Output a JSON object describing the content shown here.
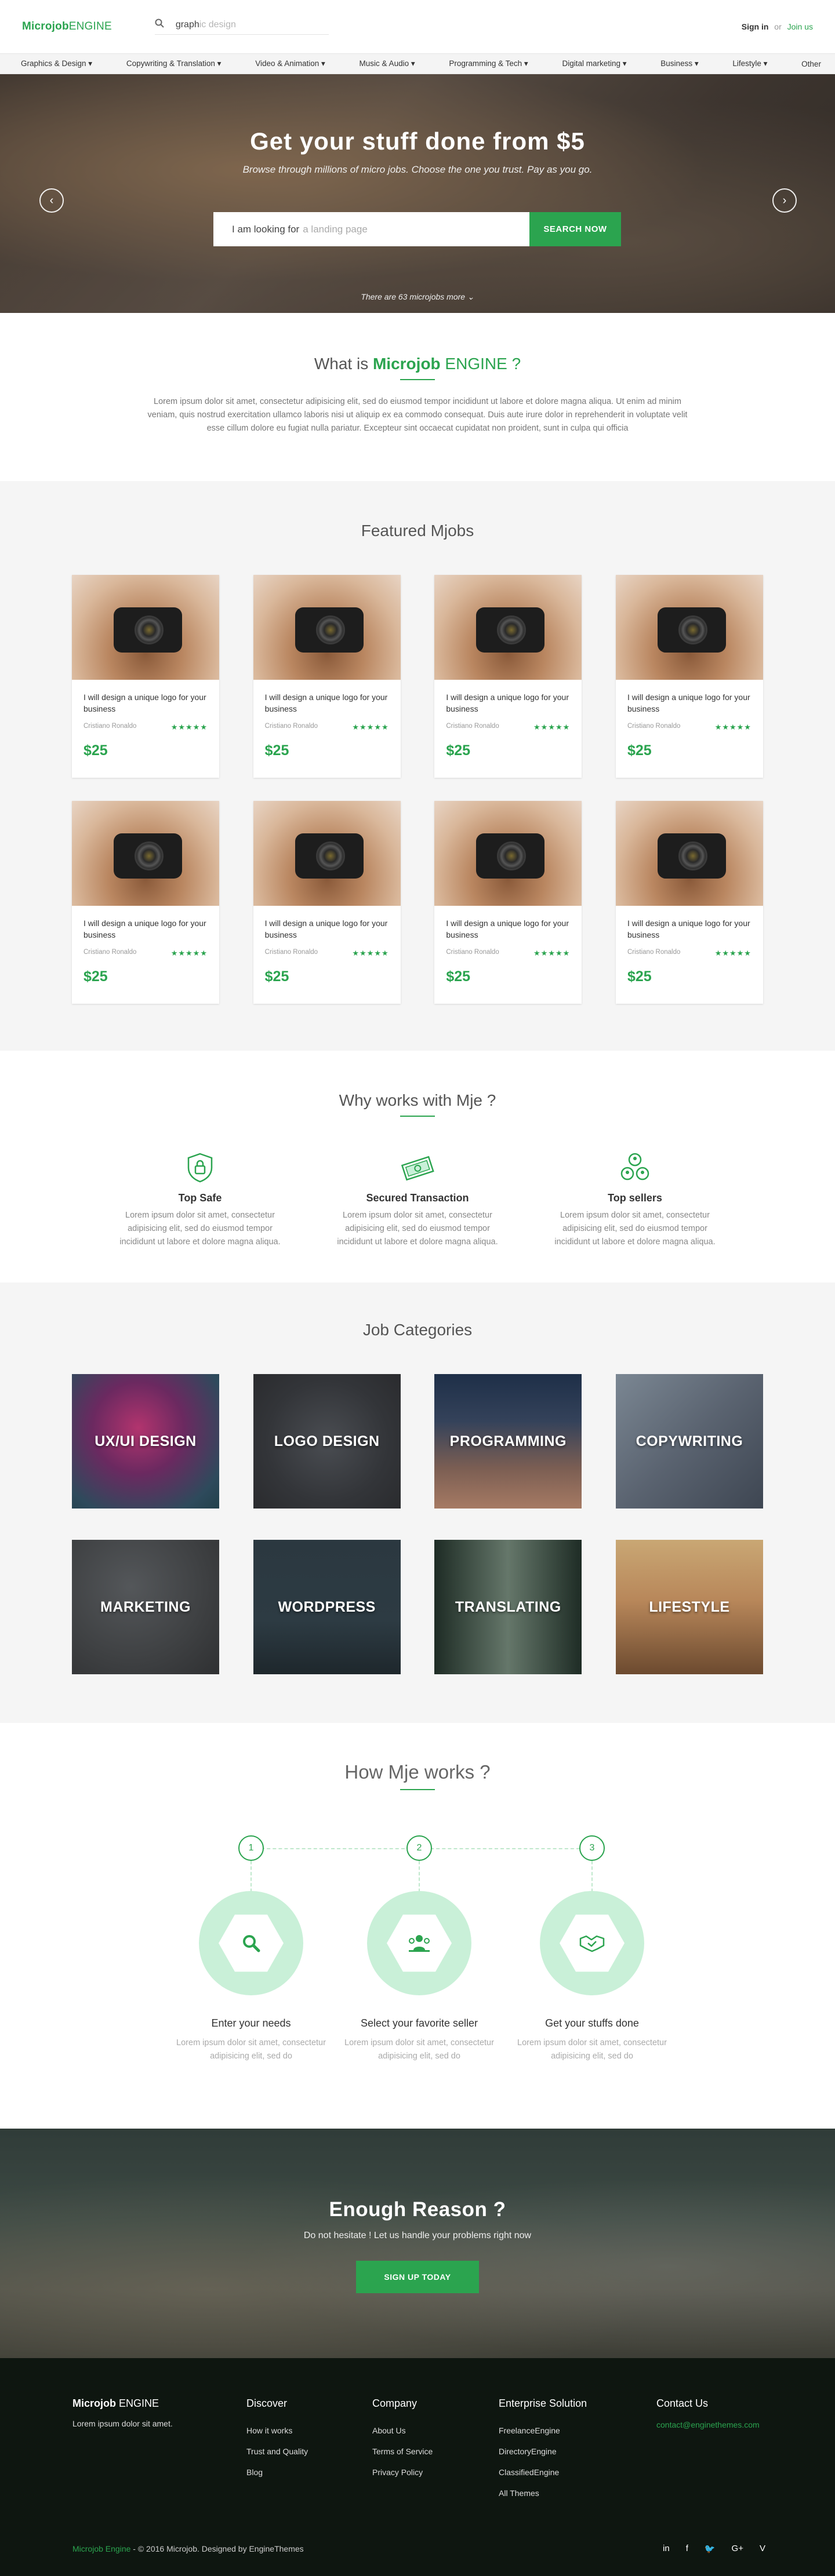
{
  "header": {
    "logo_bold": "Microjob",
    "logo_light": "ENGINE",
    "search_value": "graph",
    "search_placeholder": "ic design",
    "signin": "Sign in",
    "or": "or",
    "join": "Join us"
  },
  "catnav": [
    "Graphics & Design ▾",
    "Copywriting & Translation ▾",
    "Video & Animation ▾",
    "Music & Audio ▾",
    "Programming & Tech ▾",
    "Digital marketing ▾",
    "Business ▾",
    "Lifestyle ▾",
    "Other"
  ],
  "hero": {
    "title": "Get your stuff done from $5",
    "subtitle": "Browse through millions of micro jobs. Choose the one you trust. Pay as you go.",
    "search_label": "I am looking for",
    "search_placeholder": "a landing page",
    "search_button": "SEARCH NOW",
    "more": "There are 63 microjobs more ⌄"
  },
  "about": {
    "title_pre": "What is ",
    "title_bold": "Microjob",
    "title_post": " ENGINE ?",
    "text": "Lorem ipsum dolor sit amet, consectetur adipisicing elit, sed do eiusmod tempor incididunt ut labore et dolore magna aliqua. Ut enim ad minim veniam, quis nostrud exercitation ullamco laboris nisi ut aliquip ex ea commodo consequat. Duis aute irure dolor in reprehenderit in voluptate velit esse cillum dolore eu fugiat nulla pariatur. Excepteur sint occaecat cupidatat non proident, sunt in culpa qui officia"
  },
  "featured": {
    "title": "Featured Mjobs",
    "cards": [
      {
        "title": "I will design a unique logo for your business",
        "author": "Cristiano Ronaldo",
        "stars": "★★★★★",
        "price": "$25"
      },
      {
        "title": "I will design a unique logo for your business",
        "author": "Cristiano Ronaldo",
        "stars": "★★★★★",
        "price": "$25"
      },
      {
        "title": "I will design a unique logo for your business",
        "author": "Cristiano Ronaldo",
        "stars": "★★★★★",
        "price": "$25"
      },
      {
        "title": "I will design a unique logo for your business",
        "author": "Cristiano Ronaldo",
        "stars": "★★★★★",
        "price": "$25"
      },
      {
        "title": "I will design a unique logo for your business",
        "author": "Cristiano Ronaldo",
        "stars": "★★★★★",
        "price": "$25"
      },
      {
        "title": "I will design a unique logo for your business",
        "author": "Cristiano Ronaldo",
        "stars": "★★★★★",
        "price": "$25"
      },
      {
        "title": "I will design a unique logo for your business",
        "author": "Cristiano Ronaldo",
        "stars": "★★★★★",
        "price": "$25"
      },
      {
        "title": "I will design a unique logo for your business",
        "author": "Cristiano Ronaldo",
        "stars": "★★★★★",
        "price": "$25"
      }
    ]
  },
  "why": {
    "title": "Why works with Mje ?",
    "items": [
      {
        "icon": "safe-lock-icon",
        "title": "Top Safe",
        "text": "Lorem ipsum dolor sit amet, consectetur adipisicing elit, sed do eiusmod tempor incididunt ut labore et dolore magna aliqua."
      },
      {
        "icon": "money-icon",
        "title": "Secured Transaction",
        "text": "Lorem ipsum dolor sit amet, consectetur adipisicing elit, sed do eiusmod tempor incididunt ut labore et dolore magna aliqua."
      },
      {
        "icon": "sellers-icon",
        "title": "Top sellers",
        "text": "Lorem ipsum dolor sit amet, consectetur adipisicing elit, sed do eiusmod tempor incididunt ut labore et dolore magna aliqua."
      }
    ]
  },
  "categories": {
    "title": "Job Categories",
    "items": [
      "UX/UI DESIGN",
      "LOGO DESIGN",
      "PROGRAMMING",
      "COPYWRITING",
      "MARKETING",
      "WORDPRESS",
      "TRANSLATING",
      "LIFESTYLE"
    ]
  },
  "how": {
    "title": "How Mje works ?",
    "steps": [
      {
        "num": "1",
        "icon": "search-icon",
        "title": "Enter your needs",
        "text": "Lorem ipsum dolor sit amet, consectetur adipisicing elit, sed do"
      },
      {
        "num": "2",
        "icon": "users-icon",
        "title": "Select your favorite seller",
        "text": "Lorem ipsum dolor sit amet, consectetur adipisicing elit, sed do"
      },
      {
        "num": "3",
        "icon": "handshake-icon",
        "title": "Get your stuffs done",
        "text": "Lorem ipsum dolor sit amet, consectetur adipisicing elit, sed do"
      }
    ]
  },
  "cta": {
    "title": "Enough Reason ?",
    "text": "Do not hesitate ! Let us handle your problems right now",
    "button": "SIGN UP TODAY"
  },
  "footer": {
    "logo_bold": "Microjob",
    "logo_light": "ENGINE",
    "desc": "Lorem ipsum dolor sit amet.",
    "discover": {
      "title": "Discover",
      "links": [
        "How it works",
        "Trust and Quality",
        "Blog"
      ]
    },
    "company": {
      "title": "Company",
      "links": [
        "About Us",
        "Terms of Service",
        "Privacy Policy"
      ]
    },
    "enterprise": {
      "title": "Enterprise Solution",
      "links": [
        "FreelanceEngine",
        "DirectoryEngine",
        "ClassifiedEngine",
        "All Themes"
      ]
    },
    "contact": {
      "title": "Contact Us",
      "email": "contact@enginethemes.com"
    },
    "copyright_brand": "Microjob Engine",
    "copyright_text": " - © 2016 Microjob. Designed by EngineThemes",
    "social": [
      "in",
      "f",
      "🐦",
      "G+",
      "V"
    ]
  },
  "colors": {
    "accent": "#2ba44f",
    "footer_bg": "#0e1610",
    "section_bg": "#f5f5f5"
  }
}
